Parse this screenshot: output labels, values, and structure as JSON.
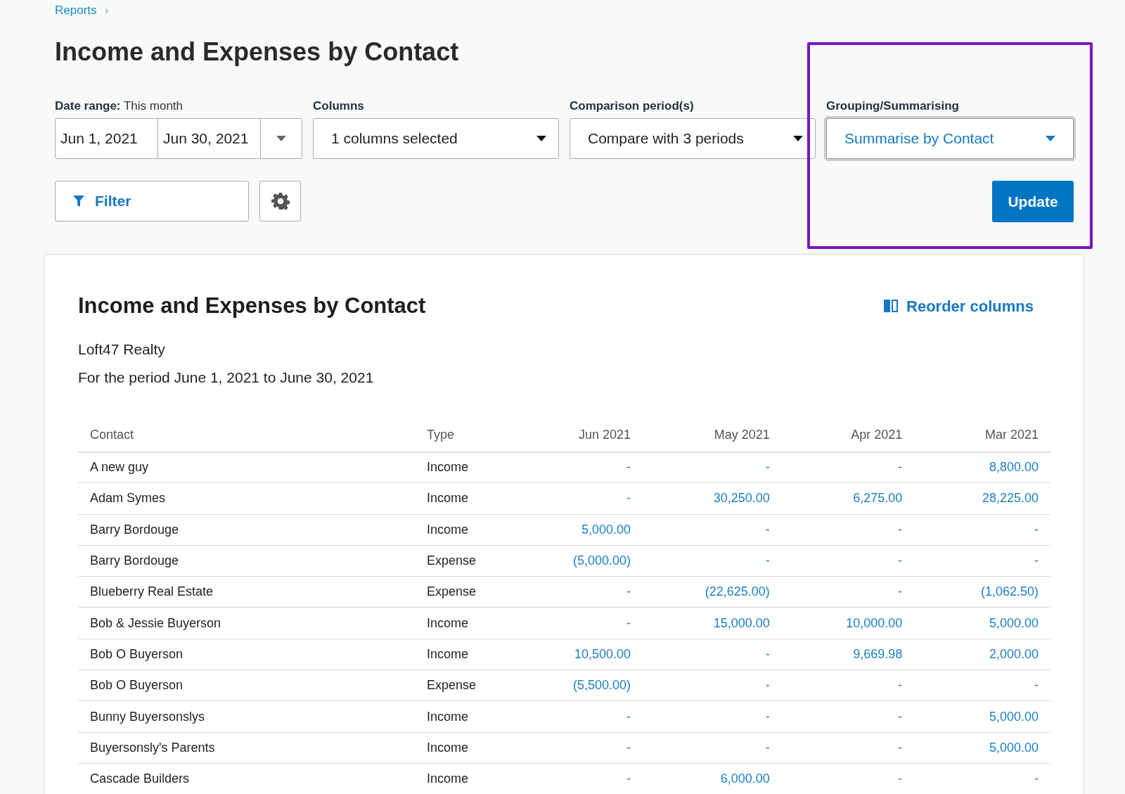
{
  "breadcrumb": {
    "label": "Reports",
    "separator": "›"
  },
  "page_title": "Income and Expenses by Contact",
  "controls": {
    "date_range": {
      "label": "Date range:",
      "value": "This month",
      "start": "Jun 1, 2021",
      "end": "Jun 30, 2021"
    },
    "columns": {
      "label": "Columns",
      "value": "1 columns selected"
    },
    "comparison": {
      "label": "Comparison period(s)",
      "value": "Compare with 3 periods"
    },
    "grouping": {
      "label": "Grouping/Summarising",
      "value": "Summarise by Contact",
      "focused": true,
      "highlighted": true
    },
    "filter_button": "Filter",
    "update_button": "Update"
  },
  "report": {
    "title": "Income and Expenses by Contact",
    "reorder_link": "Reorder columns",
    "company": "Loft47 Realty",
    "period": "For the period June 1, 2021 to June 30, 2021",
    "table": {
      "columns": [
        "Contact",
        "Type",
        "Jun 2021",
        "May 2021",
        "Apr 2021",
        "Mar 2021"
      ],
      "rows": [
        [
          "A new guy",
          "Income",
          "-",
          "-",
          "-",
          "8,800.00"
        ],
        [
          "Adam Symes",
          "Income",
          "-",
          "30,250.00",
          "6,275.00",
          "28,225.00"
        ],
        [
          "Barry Bordouge",
          "Income",
          "5,000.00",
          "-",
          "-",
          "-"
        ],
        [
          "Barry Bordouge",
          "Expense",
          "(5,000.00)",
          "-",
          "-",
          "-"
        ],
        [
          "Blueberry Real Estate",
          "Expense",
          "-",
          "(22,625.00)",
          "-",
          "(1,062.50)"
        ],
        [
          "Bob & Jessie Buyerson",
          "Income",
          "-",
          "15,000.00",
          "10,000.00",
          "5,000.00"
        ],
        [
          "Bob O Buyerson",
          "Income",
          "10,500.00",
          "-",
          "9,669.98",
          "2,000.00"
        ],
        [
          "Bob O Buyerson",
          "Expense",
          "(5,500.00)",
          "-",
          "-",
          "-"
        ],
        [
          "Bunny Buyersonslys",
          "Income",
          "-",
          "-",
          "-",
          "5,000.00"
        ],
        [
          "Buyersonsly's Parents",
          "Income",
          "-",
          "-",
          "-",
          "5,000.00"
        ],
        [
          "Cascade Builders",
          "Income",
          "-",
          "6,000.00",
          "-",
          "-"
        ]
      ]
    }
  }
}
